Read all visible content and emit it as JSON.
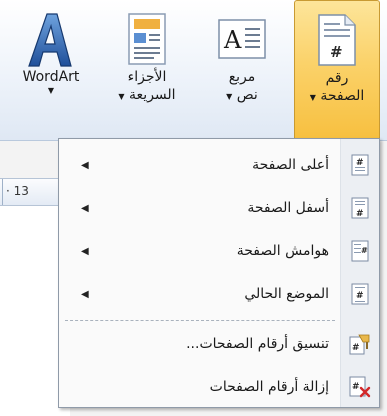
{
  "ribbon": {
    "wordart": {
      "label": "WordArt",
      "caret": "▼"
    },
    "quick_parts": {
      "line1": "الأجزاء",
      "line2": "السريعة",
      "caret": "▼"
    },
    "text_box": {
      "line1": "مربع",
      "line2": "نص",
      "caret": "▼"
    },
    "page_number": {
      "line1": "رقم",
      "line2": "الصفحة",
      "caret": "▼"
    }
  },
  "ruler": {
    "value": "· 13"
  },
  "menu": {
    "items": [
      {
        "label": "أعلى الصفحة",
        "arrow": "◀"
      },
      {
        "label": "أسفل الصفحة",
        "arrow": "◀"
      },
      {
        "label": "هوامش الصفحة",
        "arrow": "◀"
      },
      {
        "label": "الموضع الحالي",
        "arrow": "◀"
      },
      {
        "label": "تنسيق أرقام الصفحات..."
      },
      {
        "label": "إزالة أرقام الصفحات"
      }
    ]
  },
  "colors": {
    "active": "#fbd26a",
    "accent": "#2b5ea7"
  }
}
